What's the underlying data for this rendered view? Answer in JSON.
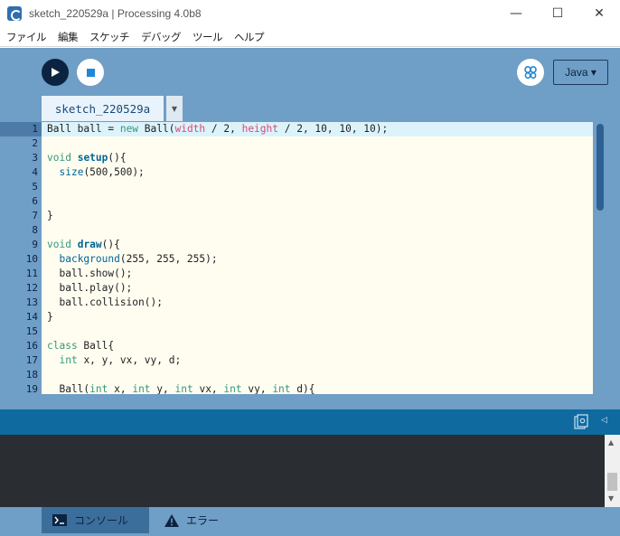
{
  "window": {
    "title": "sketch_220529a | Processing 4.0b8",
    "minimize": "—",
    "maximize": "☐",
    "close": "✕"
  },
  "menu": [
    "ファイル",
    "編集",
    "スケッチ",
    "デバッグ",
    "ツール",
    "ヘルプ"
  ],
  "toolbar": {
    "mode_label": "Java ▾"
  },
  "tab": {
    "name": "sketch_220529a",
    "arrow": "▼"
  },
  "editor": {
    "line_numbers": [
      "1",
      "2",
      "3",
      "4",
      "5",
      "6",
      "7",
      "8",
      "9",
      "10",
      "11",
      "12",
      "13",
      "14",
      "15",
      "16",
      "17",
      "18",
      "19"
    ],
    "lines": [
      [
        {
          "t": "Ball ball = "
        },
        {
          "t": "new",
          "c": "kw"
        },
        {
          "t": " Ball("
        },
        {
          "t": "width",
          "c": "var"
        },
        {
          "t": " / 2, "
        },
        {
          "t": "height",
          "c": "var"
        },
        {
          "t": " / 2, 10, 10, 10);"
        }
      ],
      [],
      [
        {
          "t": "void",
          "c": "kw"
        },
        {
          "t": " "
        },
        {
          "t": "setup",
          "c": "fn-bold"
        },
        {
          "t": "(){"
        }
      ],
      [
        {
          "t": "  "
        },
        {
          "t": "size",
          "c": "fn"
        },
        {
          "t": "(500,500);"
        }
      ],
      [],
      [],
      [
        {
          "t": "}"
        }
      ],
      [],
      [
        {
          "t": "void",
          "c": "kw"
        },
        {
          "t": " "
        },
        {
          "t": "draw",
          "c": "fn-bold"
        },
        {
          "t": "(){"
        }
      ],
      [
        {
          "t": "  "
        },
        {
          "t": "background",
          "c": "fn"
        },
        {
          "t": "(255, 255, 255);"
        }
      ],
      [
        {
          "t": "  ball.show();"
        }
      ],
      [
        {
          "t": "  ball.play();"
        }
      ],
      [
        {
          "t": "  ball.collision();"
        }
      ],
      [
        {
          "t": "}"
        }
      ],
      [],
      [
        {
          "t": "class",
          "c": "kw"
        },
        {
          "t": " Ball{"
        }
      ],
      [
        {
          "t": "  "
        },
        {
          "t": "int",
          "c": "kw"
        },
        {
          "t": " x, y, vx, vy, d;"
        }
      ],
      [],
      [
        {
          "t": "  Ball("
        },
        {
          "t": "int",
          "c": "kw"
        },
        {
          "t": " x, "
        },
        {
          "t": "int",
          "c": "kw"
        },
        {
          "t": " y, "
        },
        {
          "t": "int",
          "c": "kw"
        },
        {
          "t": " vx, "
        },
        {
          "t": "int",
          "c": "kw"
        },
        {
          "t": " vy, "
        },
        {
          "t": "int",
          "c": "kw"
        },
        {
          "t": " d){"
        }
      ]
    ]
  },
  "status": {
    "collapse_arrow": "◁"
  },
  "console_scroll": {
    "up": "▲",
    "down": "▼"
  },
  "footer": {
    "console_label": "コンソール",
    "error_label": "エラー"
  },
  "colors": {
    "accent": "#0f6aa0",
    "editor_bg": "#fffdf0",
    "chrome_bg": "#6f9ec6"
  }
}
